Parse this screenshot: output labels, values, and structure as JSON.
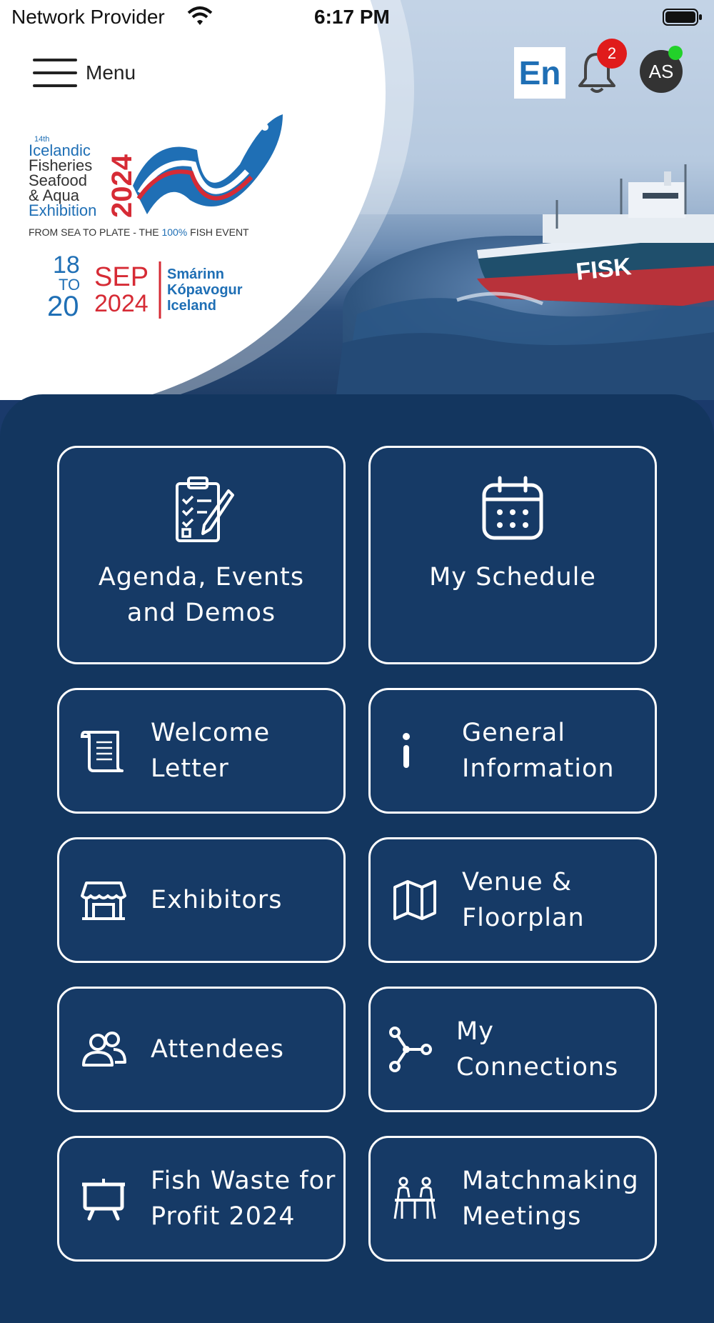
{
  "status_bar": {
    "provider": "Network Provider",
    "time": "6:17 PM"
  },
  "header": {
    "menu_label": "Menu",
    "language": "En",
    "notification_count": "2",
    "avatar_initials": "AS"
  },
  "event_logo": {
    "edition": "14th",
    "name_lines": [
      "Icelandic",
      "Fisheries",
      "Seafood",
      "& Aqua",
      "Exhibition"
    ],
    "year": "2024",
    "tagline_prefix": "FROM SEA TO PLATE - THE ",
    "tagline_highlight": "100%",
    "tagline_suffix": " FISH EVENT",
    "date_start": "18",
    "date_to": "TO",
    "date_end": "20",
    "month": "SEP",
    "date_year": "2024",
    "venue_lines": [
      "Smárinn",
      "Kópavogur",
      "Iceland"
    ]
  },
  "tiles": [
    {
      "id": "agenda",
      "label_lines": [
        "Agenda, Events",
        "and Demos"
      ],
      "icon": "clipboard-checklist-icon"
    },
    {
      "id": "schedule",
      "label_lines": [
        "My Schedule"
      ],
      "icon": "calendar-icon"
    },
    {
      "id": "welcome",
      "label_lines": [
        "Welcome",
        "Letter"
      ],
      "icon": "scroll-icon"
    },
    {
      "id": "general",
      "label_lines": [
        "General",
        "Information"
      ],
      "icon": "info-icon"
    },
    {
      "id": "exhibitors",
      "label_lines": [
        "Exhibitors"
      ],
      "icon": "storefront-icon"
    },
    {
      "id": "venue",
      "label_lines": [
        "Venue &",
        "Floorplan"
      ],
      "icon": "map-icon"
    },
    {
      "id": "attendees",
      "label_lines": [
        "Attendees"
      ],
      "icon": "users-icon"
    },
    {
      "id": "connections",
      "label_lines": [
        "My Connections"
      ],
      "icon": "network-icon"
    },
    {
      "id": "fishwaste",
      "label_lines": [
        "Fish Waste for",
        "Profit 2024"
      ],
      "icon": "presentation-board-icon"
    },
    {
      "id": "matchmaking",
      "label_lines": [
        "Matchmaking",
        "Meetings"
      ],
      "icon": "meeting-table-icon"
    }
  ],
  "colors": {
    "panel": "#13365f",
    "tile_border": "#ffffff",
    "badge": "#e01b1b",
    "online": "#22d12a",
    "logo_blue": "#1f6fb5",
    "logo_red": "#d62b35"
  }
}
